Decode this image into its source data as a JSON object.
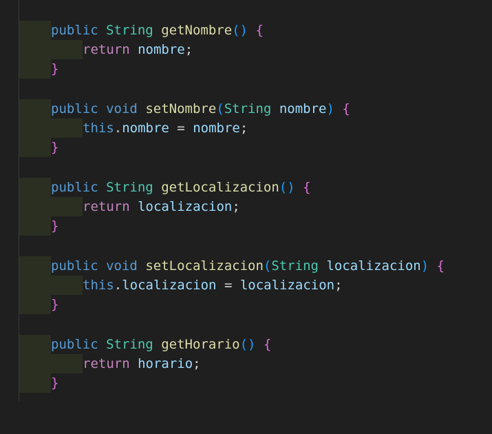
{
  "editor": {
    "blocks": [
      {
        "sig": {
          "mod": "public",
          "ret": "String",
          "name": "getNombre",
          "open": "(",
          "param_type": "",
          "param_name": "",
          "close": ")",
          "brace": "{"
        },
        "body": {
          "kw": "return",
          "expr": "nombre",
          "semi": ";"
        },
        "end": "}"
      },
      {
        "sig": {
          "mod": "public",
          "ret": "void",
          "name": "setNombre",
          "open": "(",
          "param_type": "String",
          "param_name": "nombre",
          "close": ")",
          "brace": "{"
        },
        "body": {
          "kw": "this",
          "dot": ".",
          "field": "nombre",
          "op": " = ",
          "expr": "nombre",
          "semi": ";"
        },
        "end": "}"
      },
      {
        "sig": {
          "mod": "public",
          "ret": "String",
          "name": "getLocalizacion",
          "open": "(",
          "param_type": "",
          "param_name": "",
          "close": ")",
          "brace": "{"
        },
        "body": {
          "kw": "return",
          "expr": "localizacion",
          "semi": ";"
        },
        "end": "}"
      },
      {
        "sig": {
          "mod": "public",
          "ret": "void",
          "name": "setLocalizacion",
          "open": "(",
          "param_type": "String",
          "param_name": "localizacion",
          "close": ")",
          "brace": "{"
        },
        "body": {
          "kw": "this",
          "dot": ".",
          "field": "localizacion",
          "op": " = ",
          "expr": "localizacion",
          "semi": ";"
        },
        "end": "}"
      },
      {
        "sig": {
          "mod": "public",
          "ret": "String",
          "name": "getHorario",
          "open": "(",
          "param_type": "",
          "param_name": "",
          "close": ")",
          "brace": "{"
        },
        "body": {
          "kw": "return",
          "expr": "horario",
          "semi": ";"
        },
        "end": "}"
      }
    ]
  }
}
